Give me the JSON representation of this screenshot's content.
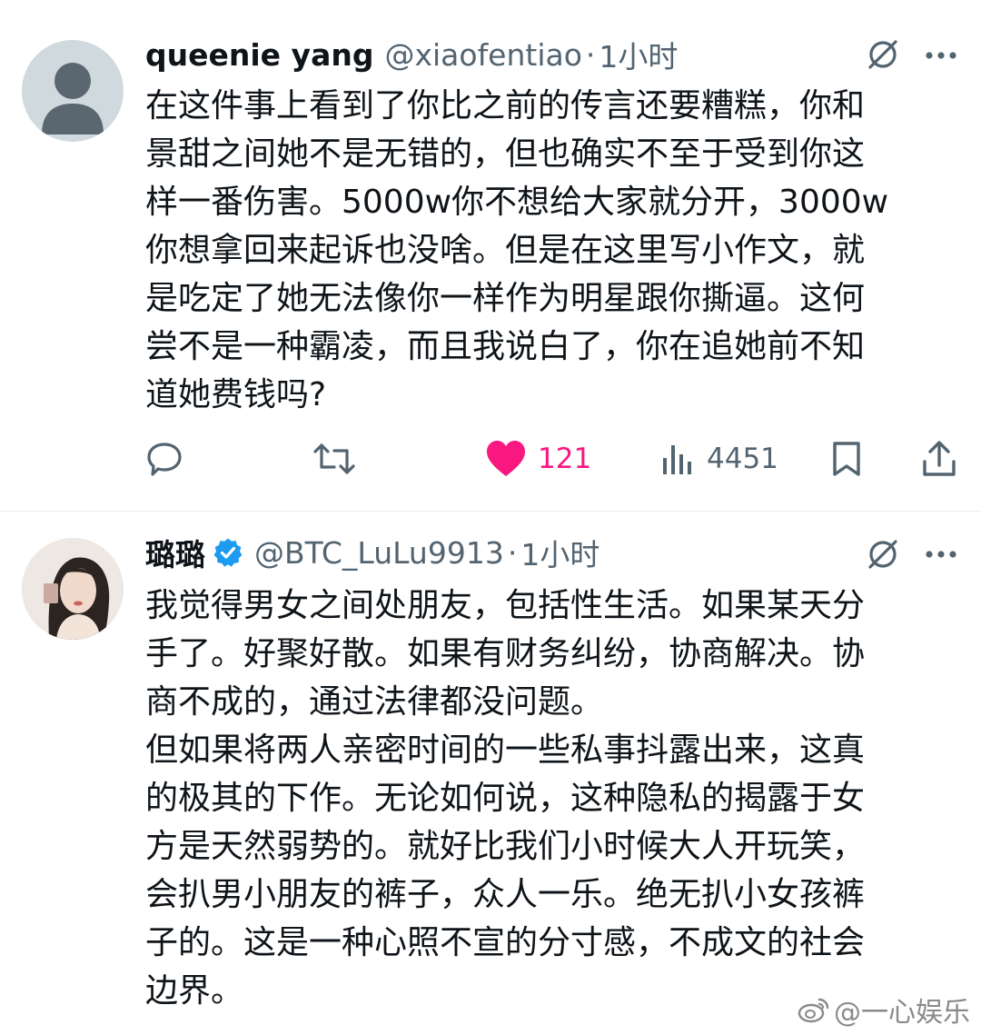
{
  "tweets": [
    {
      "name": "queenie yang",
      "handle": "@xiaofentiao",
      "separator": "·",
      "time": "1小时",
      "text": "在这件事上看到了你比之前的传言还要糟糕，你和\n景甜之间她不是无错的，但也确实不至于受到你这\n样一番伤害。5000w你不想给大家就分开，3000w\n你想拿回来起诉也没啥。但是在这里写小作文，就\n是吃定了她无法像你一样作为明星跟你撕逼。这何\n尝不是一种霸凌，而且我说白了，你在追她前不知\n道她费钱吗?",
      "likes": "121",
      "views": "4451",
      "like_color": "#f91880"
    },
    {
      "name": "璐璐",
      "handle": "@BTC_LuLu9913",
      "separator": "·",
      "time": "1小时",
      "text": "我觉得男女之间处朋友，包括性生活。如果某天分\n手了。好聚好散。如果有财务纠纷，协商解决。协\n商不成的，通过法律都没问题。\n但如果将两人亲密时间的一些私事抖露出来，这真\n的极其的下作。无论如何说，这种隐私的揭露于女\n方是天然弱势的。就好比我们小时候大人开玩笑，\n会扒男小朋友的裤子，众人一乐。绝无扒小女孩裤\n子的。这是一种心照不宣的分寸感，不成文的社会\n边界。",
      "verified_color": "#1d9bf0"
    }
  ],
  "watermark": "@一心娱乐",
  "colors": {
    "secondary_text": "#536471",
    "accent": "#1d9bf0"
  }
}
